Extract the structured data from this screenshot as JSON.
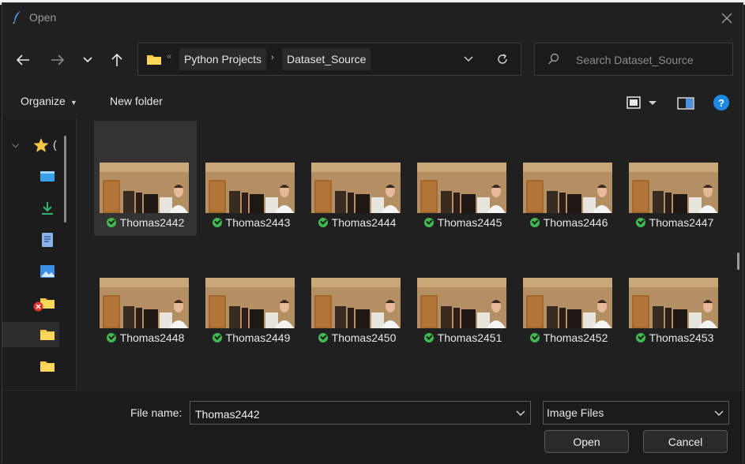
{
  "window": {
    "title": "Open"
  },
  "address": {
    "crumbs": [
      "Python Projects",
      "Dataset_Source"
    ],
    "overflow": "«"
  },
  "search": {
    "placeholder": "Search Dataset_Source"
  },
  "toolbar": {
    "organize": "Organize",
    "new_folder": "New folder",
    "help": "?"
  },
  "sidebar": {
    "items": [
      {
        "icon": "star-icon",
        "label": "("
      },
      {
        "icon": "desktop-icon"
      },
      {
        "icon": "download-icon"
      },
      {
        "icon": "document-icon"
      },
      {
        "icon": "pictures-icon"
      },
      {
        "icon": "folder-error-icon"
      },
      {
        "icon": "folder-icon"
      },
      {
        "icon": "folder-icon"
      },
      {
        "icon": "folder-icon"
      }
    ]
  },
  "files": [
    {
      "name": "Thomas2442",
      "status": "synced"
    },
    {
      "name": "Thomas2443",
      "status": "synced"
    },
    {
      "name": "Thomas2444",
      "status": "synced"
    },
    {
      "name": "Thomas2445",
      "status": "synced"
    },
    {
      "name": "Thomas2446",
      "status": "synced"
    },
    {
      "name": "Thomas2447",
      "status": "synced"
    },
    {
      "name": "Thomas2448",
      "status": "synced"
    },
    {
      "name": "Thomas2449",
      "status": "synced"
    },
    {
      "name": "Thomas2450",
      "status": "synced"
    },
    {
      "name": "Thomas2451",
      "status": "synced"
    },
    {
      "name": "Thomas2452",
      "status": "synced"
    },
    {
      "name": "Thomas2453",
      "status": "synced"
    }
  ],
  "footer": {
    "file_name_label": "File name:",
    "file_name_value": "Thomas2442",
    "file_type": "Image Files",
    "open": "Open",
    "cancel": "Cancel"
  },
  "colors": {
    "accent": "#1e88e5",
    "sync_ok": "#3fb950",
    "folder": "#f7c744"
  }
}
